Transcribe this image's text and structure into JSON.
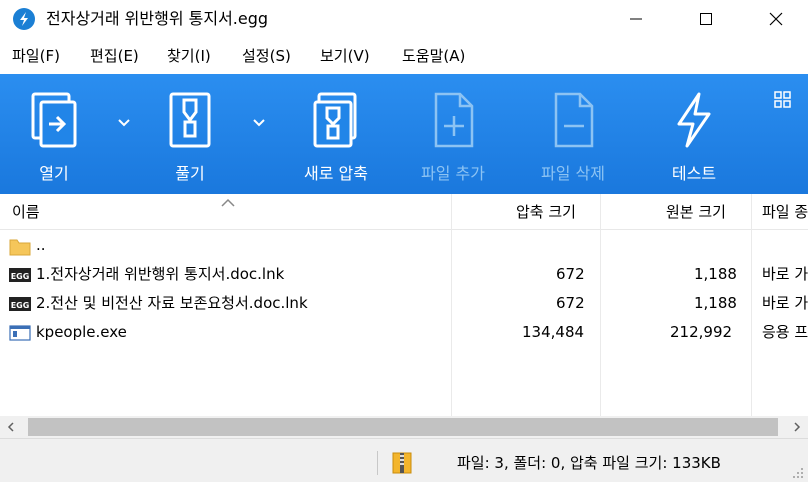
{
  "window": {
    "title": "전자상거래 위반행위 통지서.egg"
  },
  "menu": {
    "items": [
      "파일(F)",
      "편집(E)",
      "찾기(I)",
      "설정(S)",
      "보기(V)",
      "도움말(A)"
    ]
  },
  "toolbar": {
    "open_label": "열기",
    "extract_label": "풀기",
    "new_label": "새로 압축",
    "add_label": "파일 추가",
    "delete_label": "파일 삭제",
    "test_label": "테스트"
  },
  "file_list": {
    "columns": [
      "이름",
      "압축 크기",
      "원본 크기",
      "파일 종"
    ],
    "rows": [
      {
        "name": "..",
        "packed": "",
        "original": "",
        "type": ""
      },
      {
        "name": "1.전자상거래 위반행위 통지서.doc.lnk",
        "packed": "672",
        "original": "1,188",
        "type": "바로 가"
      },
      {
        "name": "2.전산 및 비전산 자료 보존요청서.doc.lnk",
        "packed": "672",
        "original": "1,188",
        "type": "바로 가"
      },
      {
        "name": "kpeople.exe",
        "packed": "134,484",
        "original": "212,992",
        "type": "응용 프"
      }
    ]
  },
  "status": {
    "summary": "파일: 3, 폴더: 0, 압축 파일 크기: 133KB"
  },
  "colors": {
    "toolbar": "#2185e8",
    "accent": "#1b7fd4",
    "folder": "#f5c65a"
  }
}
